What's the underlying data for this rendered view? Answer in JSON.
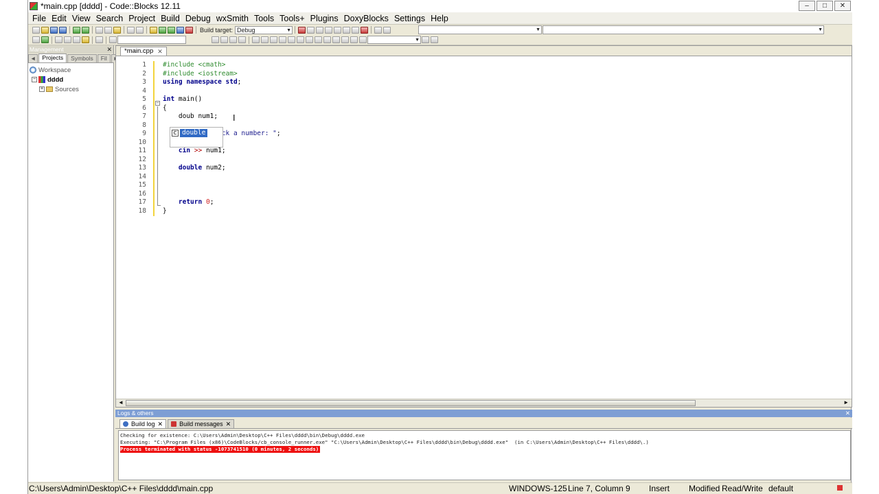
{
  "window": {
    "title": "*main.cpp [dddd] - Code::Blocks 12.11",
    "minimize": "–",
    "maximize": "□",
    "close": "✕"
  },
  "menu": [
    "File",
    "Edit",
    "View",
    "Search",
    "Project",
    "Build",
    "Debug",
    "wxSmith",
    "Tools",
    "Tools+",
    "Plugins",
    "DoxyBlocks",
    "Settings",
    "Help"
  ],
  "toolbar": {
    "build_target_label": "Build target:",
    "build_target_value": "Debug"
  },
  "management": {
    "title": "Management",
    "close": "✕",
    "tabs": [
      "Projects",
      "Symbols",
      "Fil"
    ],
    "nav_left": "◄",
    "nav_right": "►",
    "tree": {
      "workspace": "Workspace",
      "project": "dddd",
      "sources": "Sources"
    }
  },
  "editor": {
    "tab_label": "*main.cpp",
    "tab_close": "✕",
    "line_numbers": [
      "1",
      "2",
      "3",
      "4",
      "5",
      "6",
      "7",
      "8",
      "9",
      "10",
      "11",
      "12",
      "13",
      "14",
      "15",
      "16",
      "17",
      "18"
    ],
    "autocomplete": {
      "icon": "C",
      "suggestion": "double"
    }
  },
  "logs": {
    "title": "Logs & others",
    "close": "✕",
    "tabs": [
      {
        "label": "Build log"
      },
      {
        "label": "Build messages"
      }
    ],
    "tab_close": "✕",
    "lines": [
      "Checking for existence: C:\\Users\\Admin\\Desktop\\C++ Files\\dddd\\bin\\Debug\\dddd.exe",
      "Executing: \"C:\\Program Files (x86)\\CodeBlocks/cb_console_runner.exe\" \"C:\\Users\\Admin\\Desktop\\C++ Files\\dddd\\bin\\Debug\\dddd.exe\"  (in C:\\Users\\Admin\\Desktop\\C++ Files\\dddd\\.)",
      "Process terminated with status -1073741510 (0 minutes, 2 seconds)"
    ]
  },
  "status": {
    "path": "C:\\Users\\Admin\\Desktop\\C++ Files\\dddd\\main.cpp",
    "encoding": "WINDOWS-125",
    "position": "Line 7, Column 9",
    "mode": "Insert",
    "modified": "Modified",
    "access": "Read/Write",
    "lang": "default"
  }
}
